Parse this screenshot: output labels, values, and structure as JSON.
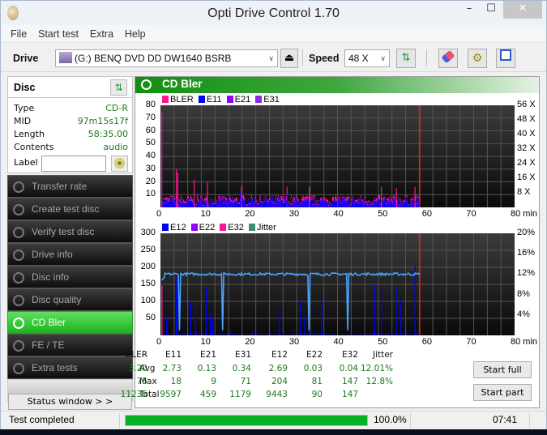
{
  "window": {
    "title": "Opti Drive Control 1.70"
  },
  "menu": [
    "File",
    "Start test",
    "Extra",
    "Help"
  ],
  "toolbar": {
    "drive_label": "Drive",
    "drive_value": "(G:)  BENQ DVD DD DW1640 BSRB",
    "speed_label": "Speed",
    "speed_value": "48 X"
  },
  "disc": {
    "heading": "Disc",
    "fields": [
      {
        "key": "Type",
        "value": "CD-R"
      },
      {
        "key": "MID",
        "value": "97m15s17f"
      },
      {
        "key": "Length",
        "value": "58:35.00"
      },
      {
        "key": "Contents",
        "value": "audio"
      }
    ],
    "label_key": "Label",
    "label_value": ""
  },
  "nav": [
    {
      "label": "Transfer rate",
      "active": false
    },
    {
      "label": "Create test disc",
      "active": false
    },
    {
      "label": "Verify test disc",
      "active": false
    },
    {
      "label": "Drive info",
      "active": false
    },
    {
      "label": "Disc info",
      "active": false
    },
    {
      "label": "Disc quality",
      "active": false
    },
    {
      "label": "CD Bler",
      "active": true
    },
    {
      "label": "FE / TE",
      "active": false
    },
    {
      "label": "Extra tests",
      "active": false
    }
  ],
  "status_window_label": "Status window > >",
  "panel": {
    "title": "CD Bler"
  },
  "chart_data": [
    {
      "type": "bar",
      "title": "BLER / E11 / E21 / E31",
      "legend": [
        {
          "name": "BLER",
          "color": "#ff1493"
        },
        {
          "name": "E11",
          "color": "#0000ff"
        },
        {
          "name": "E21",
          "color": "#9400ff"
        },
        {
          "name": "E31",
          "color": "#8a2be2"
        }
      ],
      "xlabel": "min",
      "xlim": [
        0,
        80
      ],
      "xticks": [
        0,
        10,
        20,
        30,
        40,
        50,
        60,
        70,
        80
      ],
      "xtick_labels": [
        "0",
        "10",
        "20",
        "30",
        "40",
        "50",
        "60",
        "70",
        "80 min"
      ],
      "ylim": [
        0,
        80
      ],
      "yticks": [
        10,
        20,
        30,
        40,
        50,
        60,
        70,
        80
      ],
      "y2_ticks": [
        "8 X",
        "16 X",
        "24 X",
        "32 X",
        "40 X",
        "48 X",
        "56 X"
      ],
      "end_marker_min": 58.6,
      "series_summary": {
        "BLER": {
          "typical": 5,
          "peaks": [
            [
              0.2,
              75
            ],
            [
              3.5,
              30
            ],
            [
              3.8,
              27
            ],
            [
              7.5,
              22
            ],
            [
              10.5,
              20
            ],
            [
              18.2,
              17
            ],
            [
              28.5,
              16
            ],
            [
              33.5,
              16
            ],
            [
              49.8,
              16
            ],
            [
              53.2,
              15
            ],
            [
              57.4,
              16
            ]
          ]
        },
        "E11": {
          "typical": 4,
          "peaks": [
            [
              0.2,
              18
            ],
            [
              18,
              12
            ],
            [
              28.5,
              10
            ]
          ]
        },
        "E31": {
          "typical": 0,
          "peaks": [
            [
              0.2,
              71
            ]
          ]
        }
      }
    },
    {
      "type": "bar",
      "title": "E12 / E22 / E32 / Jitter",
      "legend": [
        {
          "name": "E12",
          "color": "#0000ff"
        },
        {
          "name": "E22",
          "color": "#9400ff"
        },
        {
          "name": "E32",
          "color": "#ff1493"
        },
        {
          "name": "Jitter",
          "color": "#3c8c7c"
        }
      ],
      "xlabel": "min",
      "xlim": [
        0,
        80
      ],
      "xticks": [
        0,
        10,
        20,
        30,
        40,
        50,
        60,
        70,
        80
      ],
      "xtick_labels": [
        "0",
        "10",
        "20",
        "30",
        "40",
        "50",
        "60",
        "70",
        "80 min"
      ],
      "ylim": [
        0,
        300
      ],
      "yticks": [
        50,
        100,
        150,
        200,
        250,
        300
      ],
      "y2_ticks": [
        "4%",
        "8%",
        "12%",
        "16%",
        "20%"
      ],
      "end_marker_min": 58.6,
      "jitter_percent": {
        "typical": 12.0,
        "range": [
          11.5,
          12.8
        ]
      },
      "E12_peaks": [
        [
          0.2,
          80
        ],
        [
          1.3,
          55
        ],
        [
          3.4,
          170
        ],
        [
          3.7,
          125
        ],
        [
          6.7,
          100
        ],
        [
          7.8,
          95
        ],
        [
          10.2,
          140
        ],
        [
          11.2,
          65
        ],
        [
          11.7,
          50
        ],
        [
          26.8,
          75
        ],
        [
          31.4,
          105
        ],
        [
          32.5,
          55
        ],
        [
          36.3,
          110
        ],
        [
          48.2,
          150
        ],
        [
          49.8,
          135
        ],
        [
          53.1,
          140
        ],
        [
          54.2,
          105
        ],
        [
          57.4,
          204
        ]
      ],
      "E32_peaks": [
        [
          0.2,
          147
        ]
      ]
    }
  ],
  "stats": {
    "columns": [
      "BLER",
      "E11",
      "E21",
      "E31",
      "E12",
      "E22",
      "E32",
      "Jitter"
    ],
    "rows": [
      {
        "label": "Avg",
        "values": [
          "3.20",
          "2.73",
          "0.13",
          "0.34",
          "2.69",
          "0.03",
          "0.04",
          "12.01%"
        ]
      },
      {
        "label": "Max",
        "values": [
          "75",
          "18",
          "9",
          "71",
          "204",
          "81",
          "147",
          "12.8%"
        ]
      },
      {
        "label": "Total",
        "values": [
          "11235",
          "9597",
          "459",
          "1179",
          "9443",
          "90",
          "147",
          ""
        ]
      }
    ]
  },
  "buttons": {
    "start_full": "Start full",
    "start_part": "Start part"
  },
  "statusbar": {
    "text": "Test completed",
    "progress": 100.0,
    "progress_label": "100.0%",
    "elapsed": "07:41"
  }
}
